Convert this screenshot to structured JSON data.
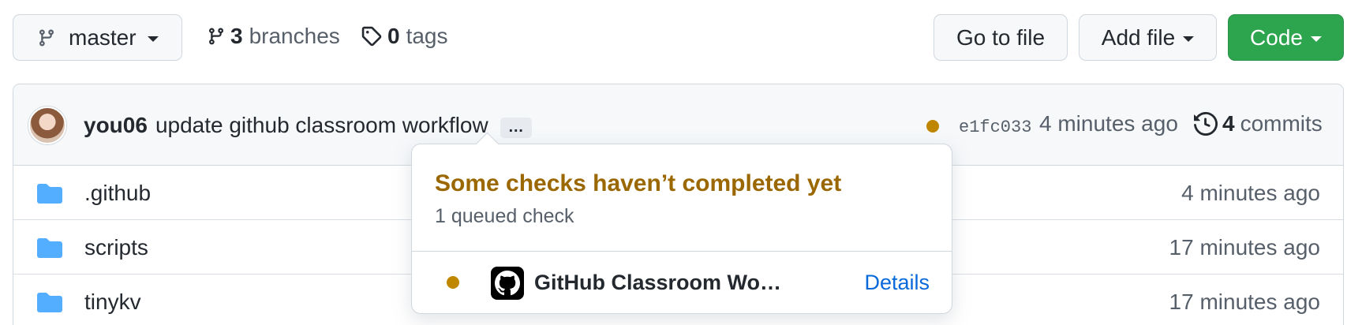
{
  "header": {
    "branch": "master",
    "branches_count": "3",
    "branches_label": "branches",
    "tags_count": "0",
    "tags_label": "tags",
    "goto_file": "Go to file",
    "add_file": "Add file",
    "code": "Code"
  },
  "commit": {
    "author": "you06",
    "message": "update github classroom workflow",
    "ellipsis": "…",
    "status": "pending",
    "sha": "e1fc033",
    "time": "4 minutes ago",
    "commits_count": "4",
    "commits_label": "commits"
  },
  "files": [
    {
      "name": ".github",
      "type": "folder",
      "date": "4 minutes ago"
    },
    {
      "name": "scripts",
      "type": "folder",
      "date": "17 minutes ago"
    },
    {
      "name": "tinykv",
      "type": "folder",
      "date": "17 minutes ago"
    }
  ],
  "popover": {
    "title": "Some checks haven’t completed yet",
    "subtitle": "1 queued check",
    "check_name": "GitHub Classroom Wo…",
    "details": "Details"
  },
  "colors": {
    "accent_green": "#2da44e",
    "pending": "#bf8700",
    "link": "#0969da",
    "folder": "#54aeff"
  },
  "icons": [
    "git-branch-icon",
    "tag-icon",
    "history-icon",
    "folder-icon",
    "github-logo-icon"
  ]
}
